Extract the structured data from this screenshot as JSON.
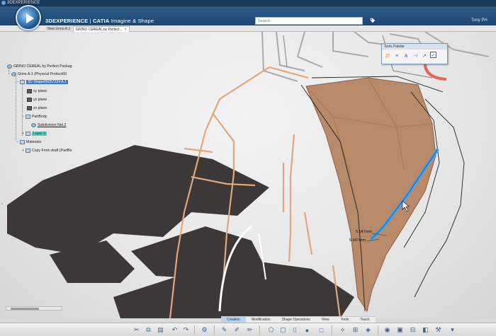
{
  "window": {
    "title": "3DEXPERIENCE"
  },
  "header": {
    "brand": "3DEXPERIENCE",
    "separator": " | ",
    "product": "CATIA",
    "app": "Imagine & Shape",
    "search_placeholder": "Search",
    "user": "Tony PH"
  },
  "tabs": [
    {
      "label": "New Grino A.1"
    },
    {
      "label": "GRINO CEREAL by Perfect...",
      "close": "×"
    }
  ],
  "tree": {
    "root": "GRINO CEREAL by Perfect Packag",
    "product": "Grino A.1 (Physical Product00",
    "shape": "3D Shape00257224 A.1",
    "planes": [
      "xy plane",
      "yz plane",
      "zx plane"
    ],
    "partbody": "PartBody",
    "subdivision": "Subdivision Net.2",
    "layer": "Layer 0",
    "materials": "Materials",
    "copy": "Copy From draft (PartBo"
  },
  "palette": {
    "title": "Tools Palette",
    "icons": [
      "sym-icon",
      "lines-icon",
      "branch-icon",
      "split-icon",
      "arrow-icon",
      "check-icon"
    ]
  },
  "dimensions": [
    "5.647mm",
    "5.647mm"
  ],
  "action_bar": {
    "tabs": [
      "Creation",
      "Modification",
      "Shape Operations",
      "View",
      "Tools",
      "Touch"
    ],
    "active": "Creation"
  },
  "colors": {
    "header": "#1d4670",
    "surface": "#b88a6a",
    "curve_highlight": "#4aa3e6",
    "wire": "#e2a67c",
    "shadow": "#3b3837",
    "selected": "#3c78c8",
    "layer": "#5ec9c4"
  }
}
